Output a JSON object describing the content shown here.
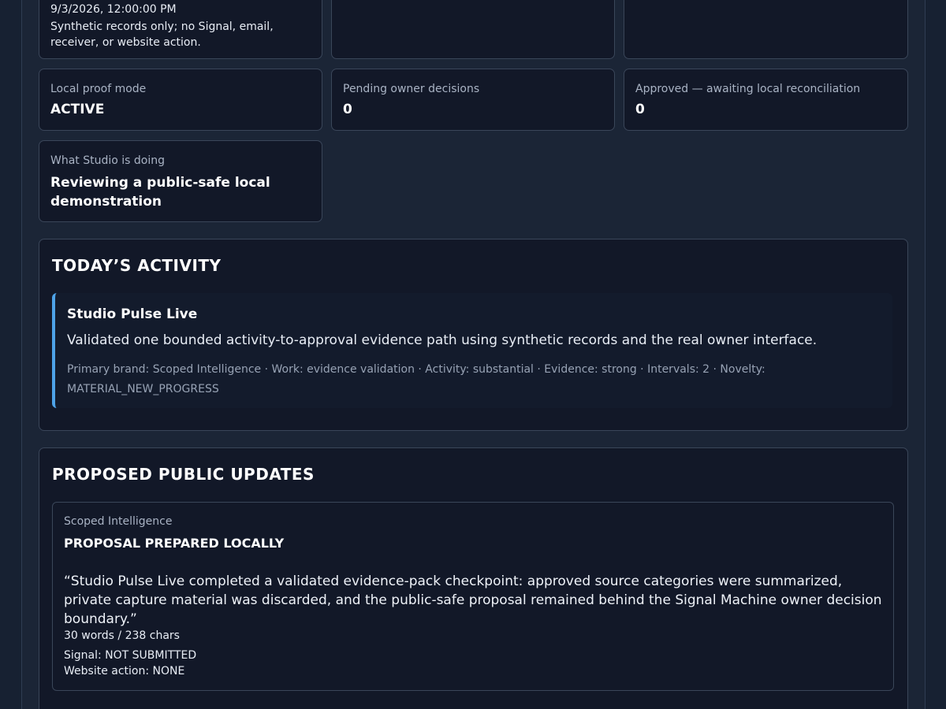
{
  "top_cards": {
    "timestamp": "9/3/2026, 12:00:00 PM",
    "note": "Synthetic records only; no Signal, email, receiver, or website action."
  },
  "stats": [
    {
      "label": "Local proof mode",
      "value": "ACTIVE"
    },
    {
      "label": "Pending owner decisions",
      "value": "0"
    },
    {
      "label": "Approved — awaiting local reconciliation",
      "value": "0"
    }
  ],
  "doing": {
    "label": "What Studio is doing",
    "value": "Reviewing a public-safe local demonstration"
  },
  "activity": {
    "title": "TODAY’S ACTIVITY",
    "item": {
      "title": "Studio Pulse Live",
      "description": "Validated one bounded activity-to-approval evidence path using synthetic records and the real owner interface.",
      "meta": "Primary brand: Scoped Intelligence · Work: evidence validation · Activity: substantial · Evidence: strong · Intervals: 2 · Novelty: MATERIAL_NEW_PROGRESS"
    }
  },
  "proposals": {
    "title": "PROPOSED PUBLIC UPDATES",
    "item": {
      "brand": "Scoped Intelligence",
      "status": "PROPOSAL PREPARED LOCALLY",
      "quote": "“Studio Pulse Live completed a validated evidence-pack checkpoint: approved source categories were summarized, private capture material was discarded, and the public-safe proposal remained behind the Signal Machine owner decision boundary.”",
      "count": "30 words / 238 chars",
      "signal": "Signal: NOT SUBMITTED",
      "website": "Website action: NONE"
    }
  }
}
